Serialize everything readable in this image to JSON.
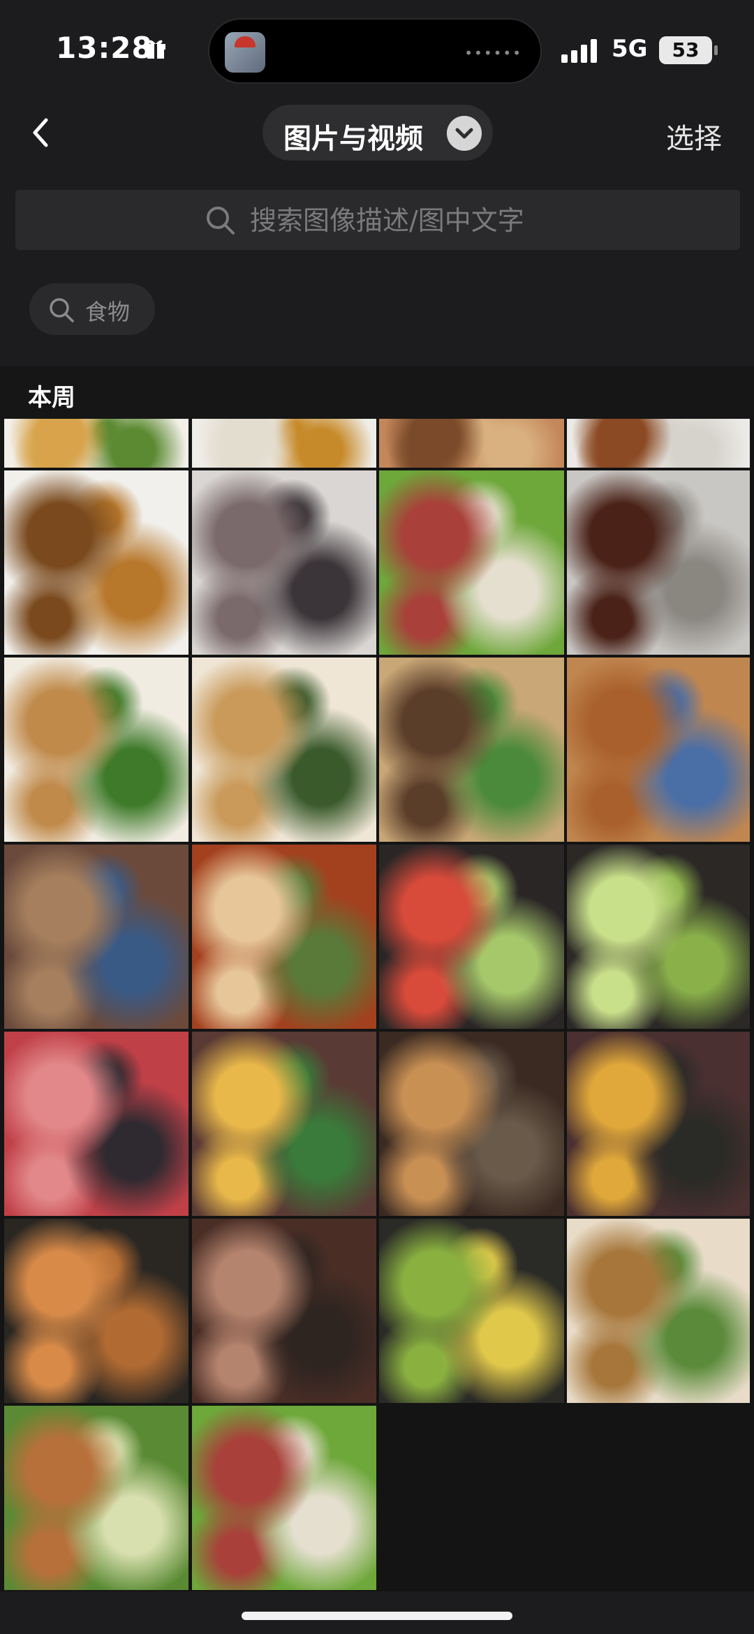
{
  "status_bar": {
    "time": "13:28",
    "network": "5G",
    "battery": "53",
    "icons": [
      "gift-icon",
      "signal-icon",
      "battery-icon"
    ]
  },
  "nav": {
    "back_icon": "chevron-left-icon",
    "title": "图片与视频",
    "title_dropdown_icon": "chevron-down-icon",
    "select_label": "选择"
  },
  "search": {
    "placeholder": "搜索图像描述/图中文字",
    "value": "",
    "icon": "search-icon"
  },
  "filter_chip": {
    "label": "食物",
    "icon": "search-icon"
  },
  "section": {
    "title": "本周"
  },
  "photos": [
    {
      "subject": "tray-meal",
      "colors": [
        "#f2efe8",
        "#d8a34a",
        "#5b8a32"
      ]
    },
    {
      "subject": "rice-plate",
      "colors": [
        "#efede8",
        "#e3ddd0",
        "#c78a2a"
      ]
    },
    {
      "subject": "noodle-stirfry",
      "colors": [
        "#c4875a",
        "#7a4a2a",
        "#d9b180"
      ]
    },
    {
      "subject": "braised-dish",
      "colors": [
        "#eceae6",
        "#8b4a23",
        "#d6d3cc"
      ]
    },
    {
      "subject": "tray-meal-mushroom",
      "colors": [
        "#f1f0ec",
        "#7a4a1e",
        "#b8782c"
      ]
    },
    {
      "subject": "raw-fish",
      "colors": [
        "#d9d6d3",
        "#7b6a6c",
        "#3b3438"
      ]
    },
    {
      "subject": "lettuce-chili",
      "colors": [
        "#6ea73a",
        "#a9403a",
        "#e5dfcf"
      ]
    },
    {
      "subject": "dark-soup",
      "colors": [
        "#c9c7c4",
        "#4a2218",
        "#8a8680"
      ]
    },
    {
      "subject": "shredded-greens",
      "colors": [
        "#f1ece2",
        "#c08a4b",
        "#3e7a2a"
      ]
    },
    {
      "subject": "tofu-skin-salad",
      "colors": [
        "#efe6d6",
        "#c99a5a",
        "#3a5a2c"
      ]
    },
    {
      "subject": "tofu-skin-chili",
      "colors": [
        "#c9a777",
        "#5b3e2a",
        "#4a8a3a"
      ]
    },
    {
      "subject": "fried-cutlet",
      "colors": [
        "#c08650",
        "#a9602c",
        "#4a6ea6"
      ]
    },
    {
      "subject": "braised-chicken-feet",
      "colors": [
        "#6b4a3c",
        "#a6805e",
        "#3a5a86"
      ]
    },
    {
      "subject": "spicy-noodle-soup",
      "colors": [
        "#a3401e",
        "#e7c79a",
        "#5a7a3a"
      ]
    },
    {
      "subject": "cucumber-chili",
      "colors": [
        "#2a2626",
        "#d84a3a",
        "#a6c86a"
      ]
    },
    {
      "subject": "cucumber-rolls",
      "colors": [
        "#2b2826",
        "#c9e08a",
        "#8ab04a"
      ]
    },
    {
      "subject": "watermelon",
      "colors": [
        "#c04048",
        "#e2888a",
        "#2f2a30"
      ]
    },
    {
      "subject": "braised-meat-corn",
      "colors": [
        "#5a3a34",
        "#e8b84a",
        "#3a7a3a"
      ]
    },
    {
      "subject": "stewed-balls",
      "colors": [
        "#3a2a22",
        "#c99054",
        "#6a5a4a"
      ]
    },
    {
      "subject": "stew-corn",
      "colors": [
        "#4a3030",
        "#e0a83a",
        "#2a2a26"
      ]
    },
    {
      "subject": "quail-eggs",
      "colors": [
        "#2a2622",
        "#d88a48",
        "#b06a32"
      ]
    },
    {
      "subject": "braised-eggs",
      "colors": [
        "#4a2e26",
        "#b5846e",
        "#2e2420"
      ]
    },
    {
      "subject": "cucumber-fungus",
      "colors": [
        "#2a2a26",
        "#8ab040",
        "#e0c84a"
      ]
    },
    {
      "subject": "rice-noodle-salad",
      "colors": [
        "#e8dcc8",
        "#a6763a",
        "#5a8a3a"
      ]
    },
    {
      "subject": "sprout-salad",
      "colors": [
        "#5a8a34",
        "#b8703a",
        "#d9e0b0"
      ]
    },
    {
      "subject": "lettuce-chili-2",
      "colors": [
        "#6ea73a",
        "#a9403a",
        "#e5dfcf"
      ]
    }
  ]
}
